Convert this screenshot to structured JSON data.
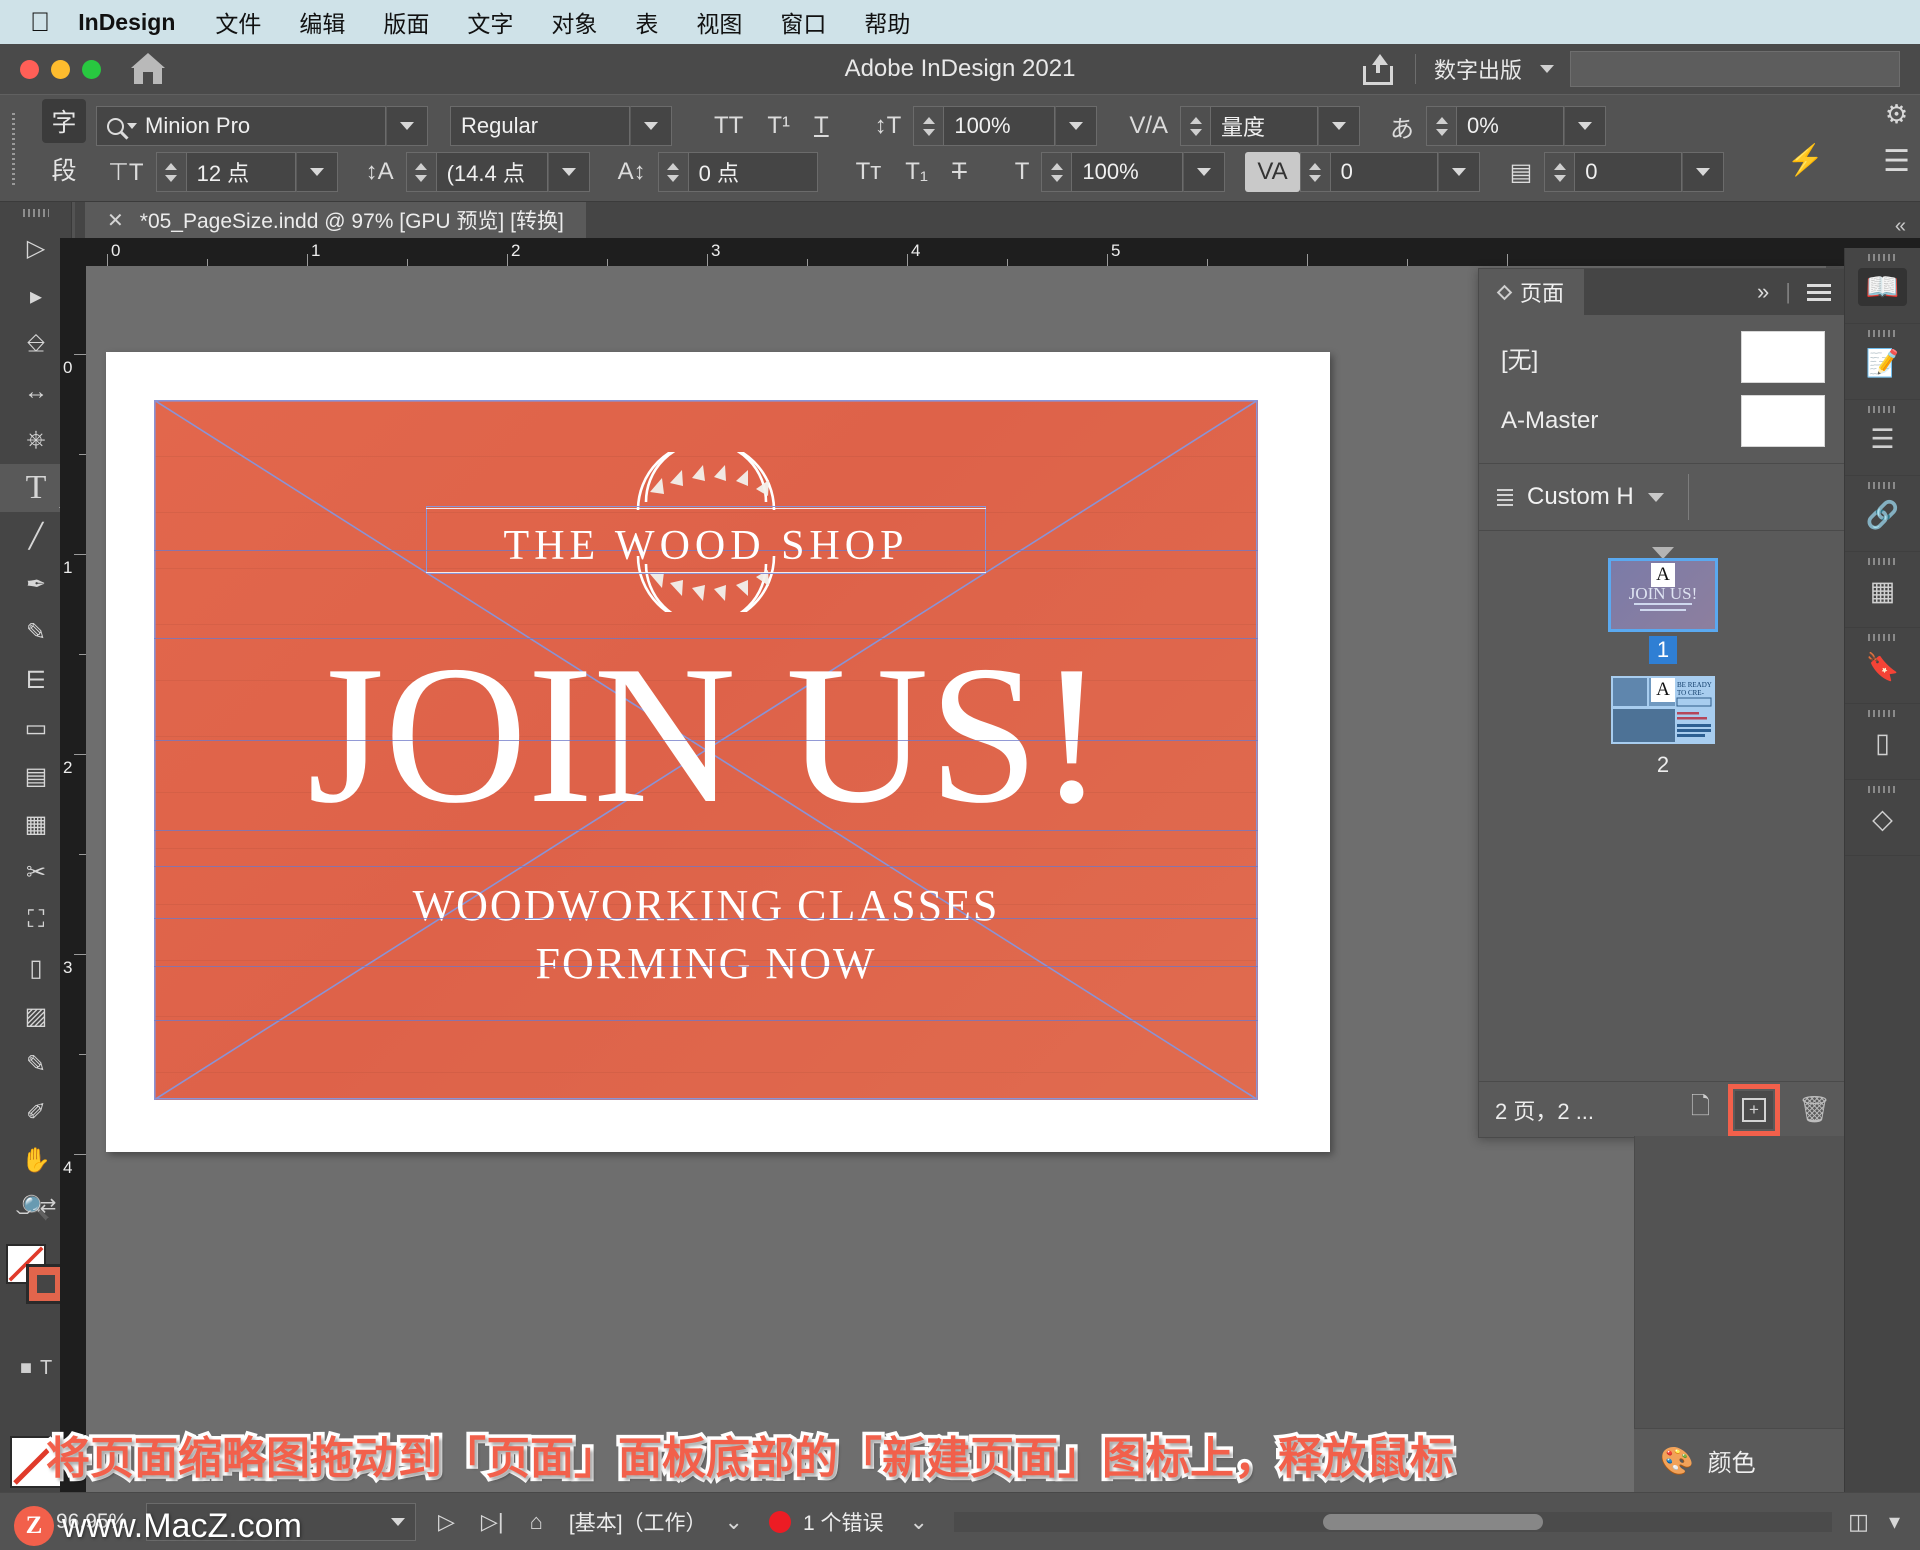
{
  "macbar": {
    "apple_icon": "apple-logo-icon",
    "app_name": "InDesign",
    "menus": [
      "文件",
      "编辑",
      "版面",
      "文字",
      "对象",
      "表",
      "视图",
      "窗口",
      "帮助"
    ]
  },
  "titlebar": {
    "title": "Adobe InDesign 2021",
    "share_icon": "share-icon",
    "publish_label": "数字出版",
    "home_icon": "home-icon",
    "search_placeholder": ""
  },
  "control_panel": {
    "mode_char_label": "字",
    "mode_para_label": "段",
    "font_family": "Minion Pro",
    "font_style": "Regular",
    "font_size": "12 点",
    "leading": "(14.4 点",
    "kerning_baseline": "0 点",
    "case_all_caps": "TT",
    "case_superscript": "T¹",
    "case_underline": "T",
    "case_small_caps": "Tᴛ",
    "case_subscript": "T₁",
    "case_strike": "T",
    "vertical_scale": "100%",
    "horizontal_scale": "100%",
    "kerning_value": "量度",
    "tracking_value": "0",
    "tsume_value": "0%",
    "skew_value": "0",
    "gear_icon": "gear-icon",
    "menu_icon": "panel-menu-icon",
    "bolt_icon": "quick-apply-icon"
  },
  "document_tab": {
    "close_icon": "close-icon",
    "label": "*05_PageSize.indd @ 97% [GPU 预览] [转换]",
    "collapse_icon": "double-chevron-left-icon"
  },
  "tools": [
    {
      "name": "selection-tool",
      "glyph": "▶"
    },
    {
      "name": "direct-selection-tool",
      "glyph": "▶"
    },
    {
      "name": "page-tool",
      "glyph": "⌲"
    },
    {
      "name": "gap-tool",
      "glyph": "↔"
    },
    {
      "name": "content-collector-tool",
      "glyph": "⌸"
    },
    {
      "name": "type-tool",
      "glyph": "T"
    },
    {
      "name": "line-tool",
      "glyph": "╱"
    },
    {
      "name": "pen-tool",
      "glyph": "✒"
    },
    {
      "name": "pencil-tool",
      "glyph": "✎"
    },
    {
      "name": "frame-tool",
      "glyph": "⌧"
    },
    {
      "name": "rectangle-tool",
      "glyph": "▭"
    },
    {
      "name": "free-transform-tool",
      "glyph": "▦"
    },
    {
      "name": "table-tool",
      "glyph": "▤"
    },
    {
      "name": "scissors-tool",
      "glyph": "✂"
    },
    {
      "name": "scale-tool",
      "glyph": "⛶"
    },
    {
      "name": "gradient-swatch-tool",
      "glyph": "▧"
    },
    {
      "name": "gradient-feather-tool",
      "glyph": "▨"
    },
    {
      "name": "note-tool",
      "glyph": "☰"
    },
    {
      "name": "eyedropper-tool",
      "glyph": "✐"
    },
    {
      "name": "hand-tool",
      "glyph": "✋"
    },
    {
      "name": "zoom-tool",
      "glyph": "⚲"
    }
  ],
  "rulers": {
    "horizontal_labels": [
      "0",
      "1",
      "2",
      "3",
      "4",
      "5"
    ],
    "vertical_labels": [
      "0",
      "1",
      "2",
      "3",
      "4"
    ]
  },
  "poster": {
    "shop_title": "THE WOOD SHOP",
    "headline": "JOIN US!",
    "sub_line_1": "WOODWORKING CLASSES",
    "sub_line_2": "FORMING NOW",
    "background_color": "#e0674c"
  },
  "pages_panel": {
    "tab_label": "页面",
    "collapse_icon": "double-chevron-right-icon",
    "menu_icon": "panel-menu-icon",
    "masters": [
      {
        "label": "[无]"
      },
      {
        "label": "A-Master"
      }
    ],
    "size_preset": "Custom H",
    "pages": [
      {
        "number": "1",
        "master_badge": "A",
        "selected": true,
        "thumb_title": "JOIN US!"
      },
      {
        "number": "2",
        "master_badge": "A",
        "selected": false,
        "thumb_title": "BE READY TO CRE-"
      }
    ],
    "footer_count": "2 页，2 ...",
    "duplicate_icon": "duplicate-spread-icon",
    "new_page_icon": "new-page-icon",
    "delete_icon": "trash-icon"
  },
  "right_dock": [
    {
      "name": "pages-dock-icon",
      "active": true
    },
    {
      "name": "properties-dock-icon",
      "active": false
    },
    {
      "name": "paragraph-styles-dock-icon",
      "active": false
    },
    {
      "name": "links-dock-icon",
      "active": false
    },
    {
      "name": "object-styles-dock-icon",
      "active": false
    },
    {
      "name": "libraries-dock-icon",
      "active": false
    },
    {
      "name": "gradient-dock-icon",
      "active": false
    },
    {
      "name": "layers-dock-icon",
      "active": false
    }
  ],
  "color_panel": {
    "label": "颜色",
    "icon": "palette-icon"
  },
  "annotation": {
    "text": "将页面缩略图拖动到「页面」面板底部的「新建页面」图标上，释放鼠标",
    "color": "#f2604b"
  },
  "statusbar": {
    "zoom_level": "96.95%",
    "workspace": "[基本]（工作）",
    "error_text": "1 个错误",
    "error_color": "#ed1c24",
    "prev_page_icon": "next-page-icon",
    "last_page_icon": "last-page-icon",
    "preflight_icon": "preflight-icon"
  },
  "watermark": {
    "badge": "Z",
    "text": "www.MacZ.com"
  }
}
